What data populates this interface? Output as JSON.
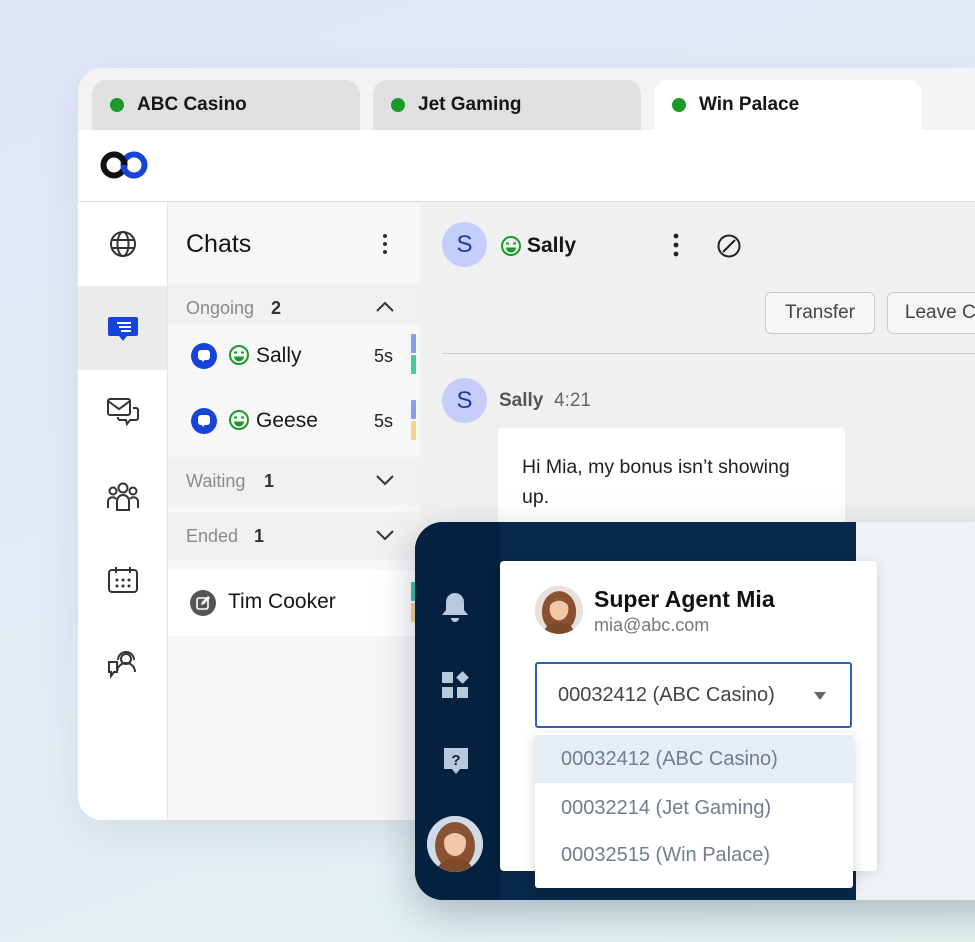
{
  "tabs": [
    {
      "label": "ABC Casino",
      "status_color": "#1a9a2b",
      "active": false
    },
    {
      "label": "Jet Gaming",
      "status_color": "#1a9a2b",
      "active": false
    },
    {
      "label": "Win Palace",
      "status_color": "#1a9a2b",
      "active": true
    }
  ],
  "rail": {
    "items": [
      {
        "icon": "globe-icon",
        "active": false
      },
      {
        "icon": "chat-bubble-icon",
        "active": true
      },
      {
        "icon": "messages-icon",
        "active": false
      },
      {
        "icon": "team-icon",
        "active": false
      },
      {
        "icon": "calendar-icon",
        "active": false
      },
      {
        "icon": "support-agent-icon",
        "active": false
      }
    ]
  },
  "chats": {
    "title": "Chats",
    "sections": {
      "ongoing": {
        "label": "Ongoing",
        "count": "2",
        "expanded": true
      },
      "waiting": {
        "label": "Waiting",
        "count": "1",
        "expanded": false
      },
      "ended": {
        "label": "Ended",
        "count": "1",
        "expanded": false
      }
    },
    "ongoing_items": [
      {
        "name": "Sally",
        "time": "5s",
        "bar_colors": [
          "#8b9cf0",
          "#3fcf9b"
        ]
      },
      {
        "name": "Geese",
        "time": "5s",
        "bar_colors": [
          "#8b9cf0",
          "#f3d28e"
        ]
      }
    ],
    "ended_items": [
      {
        "name": "Tim Cooker",
        "bar_colors": [
          "#3fbfa6",
          "#f3d28e"
        ]
      }
    ]
  },
  "conversation": {
    "header": {
      "avatar_letter": "S",
      "name": "Sally"
    },
    "transfer_label": "Transfer",
    "leave_label": "Leave Chat",
    "message": {
      "avatar_letter": "S",
      "sender": "Sally",
      "time": "4:21",
      "text": "Hi Mia, my bonus isn’t showing up."
    }
  },
  "profile": {
    "name": "Super Agent Mia",
    "email": "mia@abc.com",
    "selected_account": "00032412 (ABC Casino)",
    "options": [
      "00032412 (ABC Casino)",
      "00032214 (Jet Gaming)",
      "00032515 (Win Palace)"
    ]
  },
  "colors": {
    "accent": "#1744d8",
    "status_green": "#1a9a2b",
    "dark_panel": "#08294a",
    "select_border": "#2b63b4"
  }
}
